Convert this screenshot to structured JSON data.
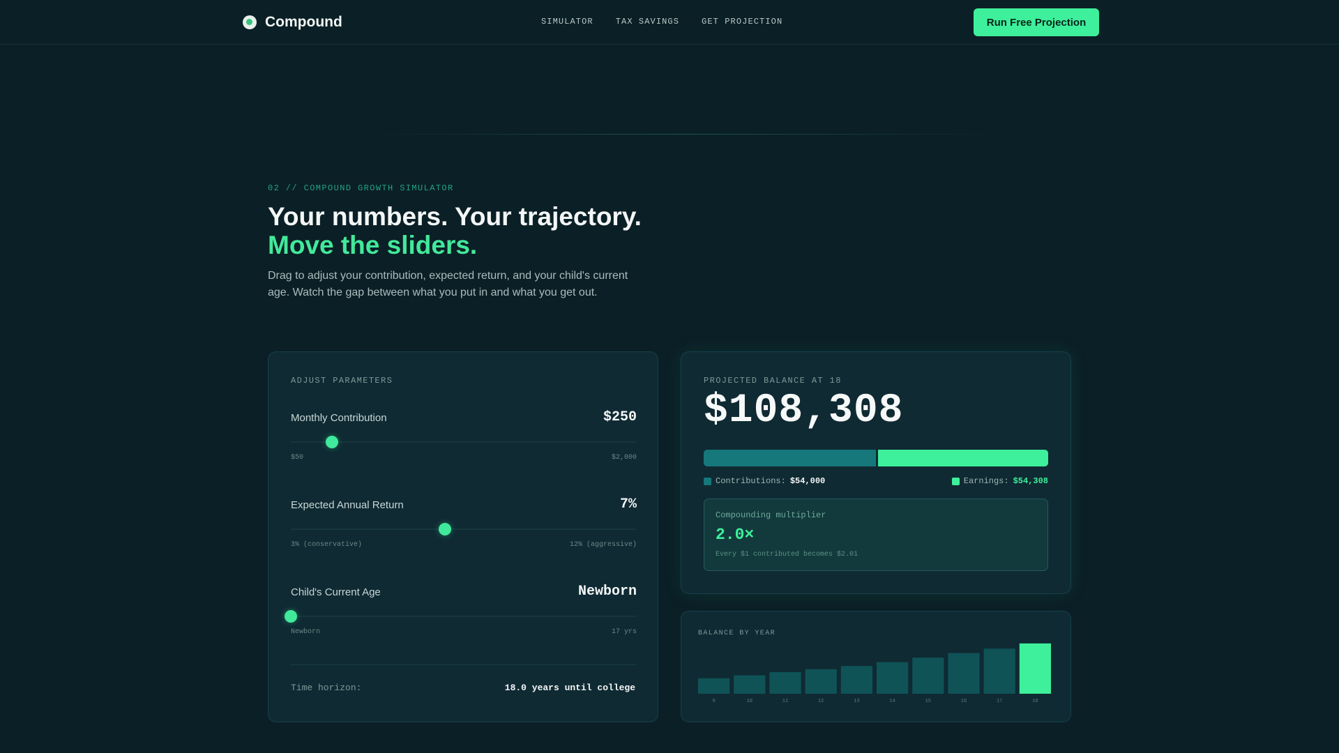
{
  "nav": {
    "brand": "Compound",
    "links": [
      "SIMULATOR",
      "TAX SAVINGS",
      "GET PROJECTION"
    ],
    "cta": "Run Free Projection"
  },
  "hero": {
    "eyebrow": "02 // COMPOUND GROWTH SIMULATOR",
    "headline_line1": "Your numbers. Your trajectory.",
    "headline_line2": "Move the sliders.",
    "lead": "Drag to adjust your contribution, expected return, and your child's current age. Watch the gap between what you put in and what you get out."
  },
  "params": {
    "label": "ADJUST PARAMETERS",
    "monthly": {
      "title": "Monthly Contribution",
      "value": "$250",
      "min_label": "$50",
      "max_label": "$2,000",
      "fraction": 0.118
    },
    "return": {
      "title": "Expected Annual Return",
      "value": "7%",
      "min_label": "3% (conservative)",
      "max_label": "12% (aggressive)",
      "fraction": 0.445
    },
    "age": {
      "title": "Child's Current Age",
      "value": "Newborn",
      "min_label": "Newborn",
      "max_label": "17 yrs",
      "fraction": 0.0
    },
    "horizon_label": "Time horizon:",
    "horizon_value": "18.0 years until college"
  },
  "result": {
    "label": "PROJECTED BALANCE AT 18",
    "balance": "$108,308",
    "contrib_fraction": 0.5,
    "contributions_label": "Contributions:",
    "contributions_value": "$54,000",
    "earnings_label": "Earnings:",
    "earnings_value": "$54,308",
    "multiplier_label": "Compounding multiplier",
    "multiplier_value": "2.0×",
    "multiplier_note": "Every $1 contributed becomes $2.01"
  },
  "colors": {
    "accent": "#3ef09b",
    "contrib": "#16787b",
    "bar": "#0f5357",
    "bar_latest": "#3ef09b"
  },
  "chart_data": {
    "type": "bar",
    "title": "BALANCE BY YEAR",
    "categories": [
      "9",
      "10",
      "11",
      "12",
      "13",
      "14",
      "15",
      "16",
      "17",
      "18"
    ],
    "values": [
      24000,
      28500,
      33500,
      38000,
      43000,
      49000,
      56000,
      63000,
      70000,
      78000
    ],
    "ylim": [
      0,
      80000
    ]
  }
}
